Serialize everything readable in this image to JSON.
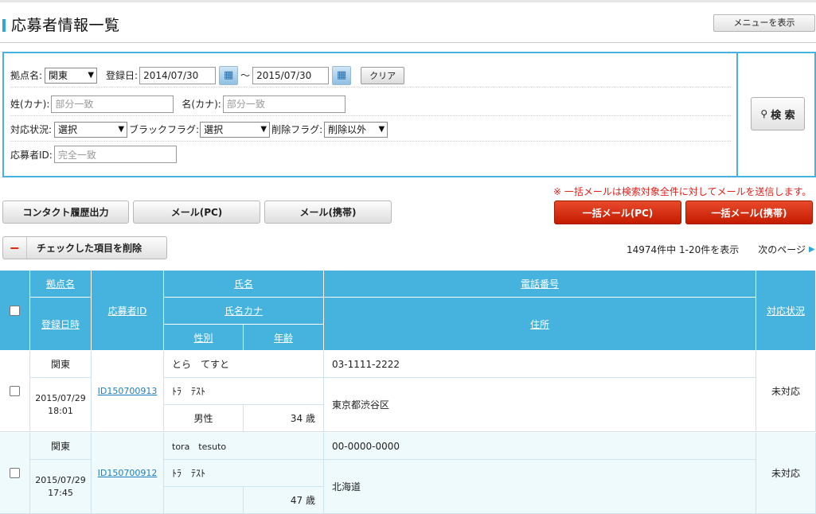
{
  "page": {
    "title": "応募者情報一覧",
    "menu_button": "メニューを表示"
  },
  "filters": {
    "location_label": "拠点名:",
    "location_value": "関東",
    "reg_date_label": "登録日:",
    "date_from": "2014/07/30",
    "tilde": "〜",
    "date_to": "2015/07/30",
    "clear_label": "クリア",
    "last_kana_label": "姓(カナ):",
    "last_kana_placeholder": "部分一致",
    "first_kana_label": "名(カナ):",
    "first_kana_placeholder": "部分一致",
    "status_label": "対応状況:",
    "status_value": "選択",
    "black_label": "ブラックフラグ:",
    "black_value": "選択",
    "delete_flag_label": "削除フラグ:",
    "delete_flag_value": "削除以外",
    "applicant_id_label": "応募者ID:",
    "applicant_id_placeholder": "完全一致",
    "search_label": "検 索"
  },
  "actions": {
    "contact_export": "コンタクト履歴出力",
    "mail_pc": "メール(PC)",
    "mail_mobile": "メール(携帯)",
    "bulk_mail_pc": "一括メール(PC)",
    "bulk_mail_mobile": "一括メール(携帯)",
    "notice": "※ 一括メールは検索対象全件に対してメールを送信します。",
    "delete_checked": "チェックした項目を削除"
  },
  "paging": {
    "summary": "14974件中  1-20件を表示",
    "next": "次のページ"
  },
  "table": {
    "headers": {
      "location": "拠点名",
      "reg_datetime": "登録日時",
      "applicant_id": "応募者ID",
      "name": "氏名",
      "name_kana": "氏名カナ",
      "gender": "性別",
      "age": "年齢",
      "phone": "電話番号",
      "address": "住所",
      "status": "対応状況"
    },
    "rows": [
      {
        "location": "関東",
        "date": "2015/07/29",
        "time": "18:01",
        "id": "ID150700913",
        "name": "とら　てすと",
        "kana": "ﾄﾗ　ﾃｽﾄ",
        "gender": "男性",
        "age": "34 歳",
        "phone": "03-1111-2222",
        "address": "東京都渋谷区",
        "status": "未対応"
      },
      {
        "location": "関東",
        "date": "2015/07/29",
        "time": "17:45",
        "id": "ID150700912",
        "name": "tora　tesuto",
        "kana": "ﾄﾗ　ﾃｽﾄ",
        "gender": "",
        "age": "47 歳",
        "phone": "00-0000-0000",
        "address": "北海道",
        "status": "未対応"
      }
    ]
  },
  "colors": {
    "accent": "#45b3dd",
    "danger": "#c41b00",
    "notice": "#e0201b"
  }
}
